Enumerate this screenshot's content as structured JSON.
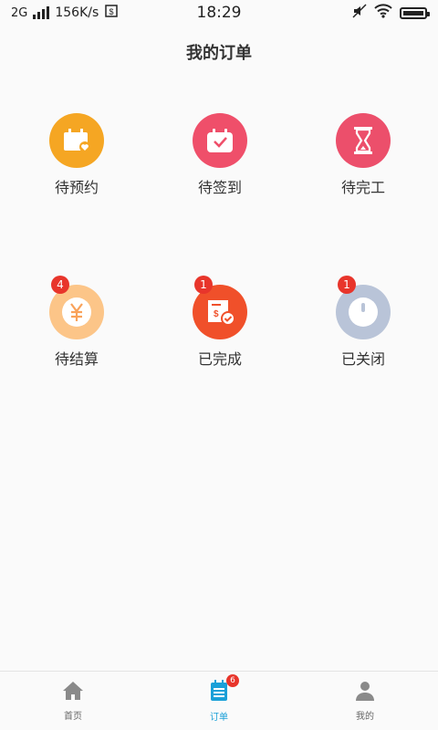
{
  "status_bar": {
    "network": "2G",
    "speed": "156K/s",
    "time": "18:29"
  },
  "page": {
    "title": "我的订单"
  },
  "order_states": [
    {
      "label": "待预约",
      "color": "#f5a623",
      "icon": "calendar-heart-icon",
      "badge": null
    },
    {
      "label": "待签到",
      "color": "#ef4f6a",
      "icon": "calendar-check-icon",
      "badge": null
    },
    {
      "label": "待完工",
      "color": "#ec4f6b",
      "icon": "hourglass-icon",
      "badge": null
    },
    {
      "label": "待结算",
      "color": "#fcc588",
      "icon": "yuan-coin-icon",
      "badge": "4"
    },
    {
      "label": "已完成",
      "color": "#f0502a",
      "icon": "receipt-check-icon",
      "badge": "1"
    },
    {
      "label": "已关闭",
      "color": "#b9c4d8",
      "icon": "power-icon",
      "badge": "1"
    }
  ],
  "bottom_nav": {
    "items": [
      {
        "label": "首页",
        "icon": "home-icon"
      },
      {
        "label": "订单",
        "icon": "order-list-icon",
        "badge": "6",
        "active": true
      },
      {
        "label": "我的",
        "icon": "user-icon"
      }
    ]
  },
  "colors": {
    "accent": "#1aa0d8",
    "badge": "#e8352b"
  }
}
